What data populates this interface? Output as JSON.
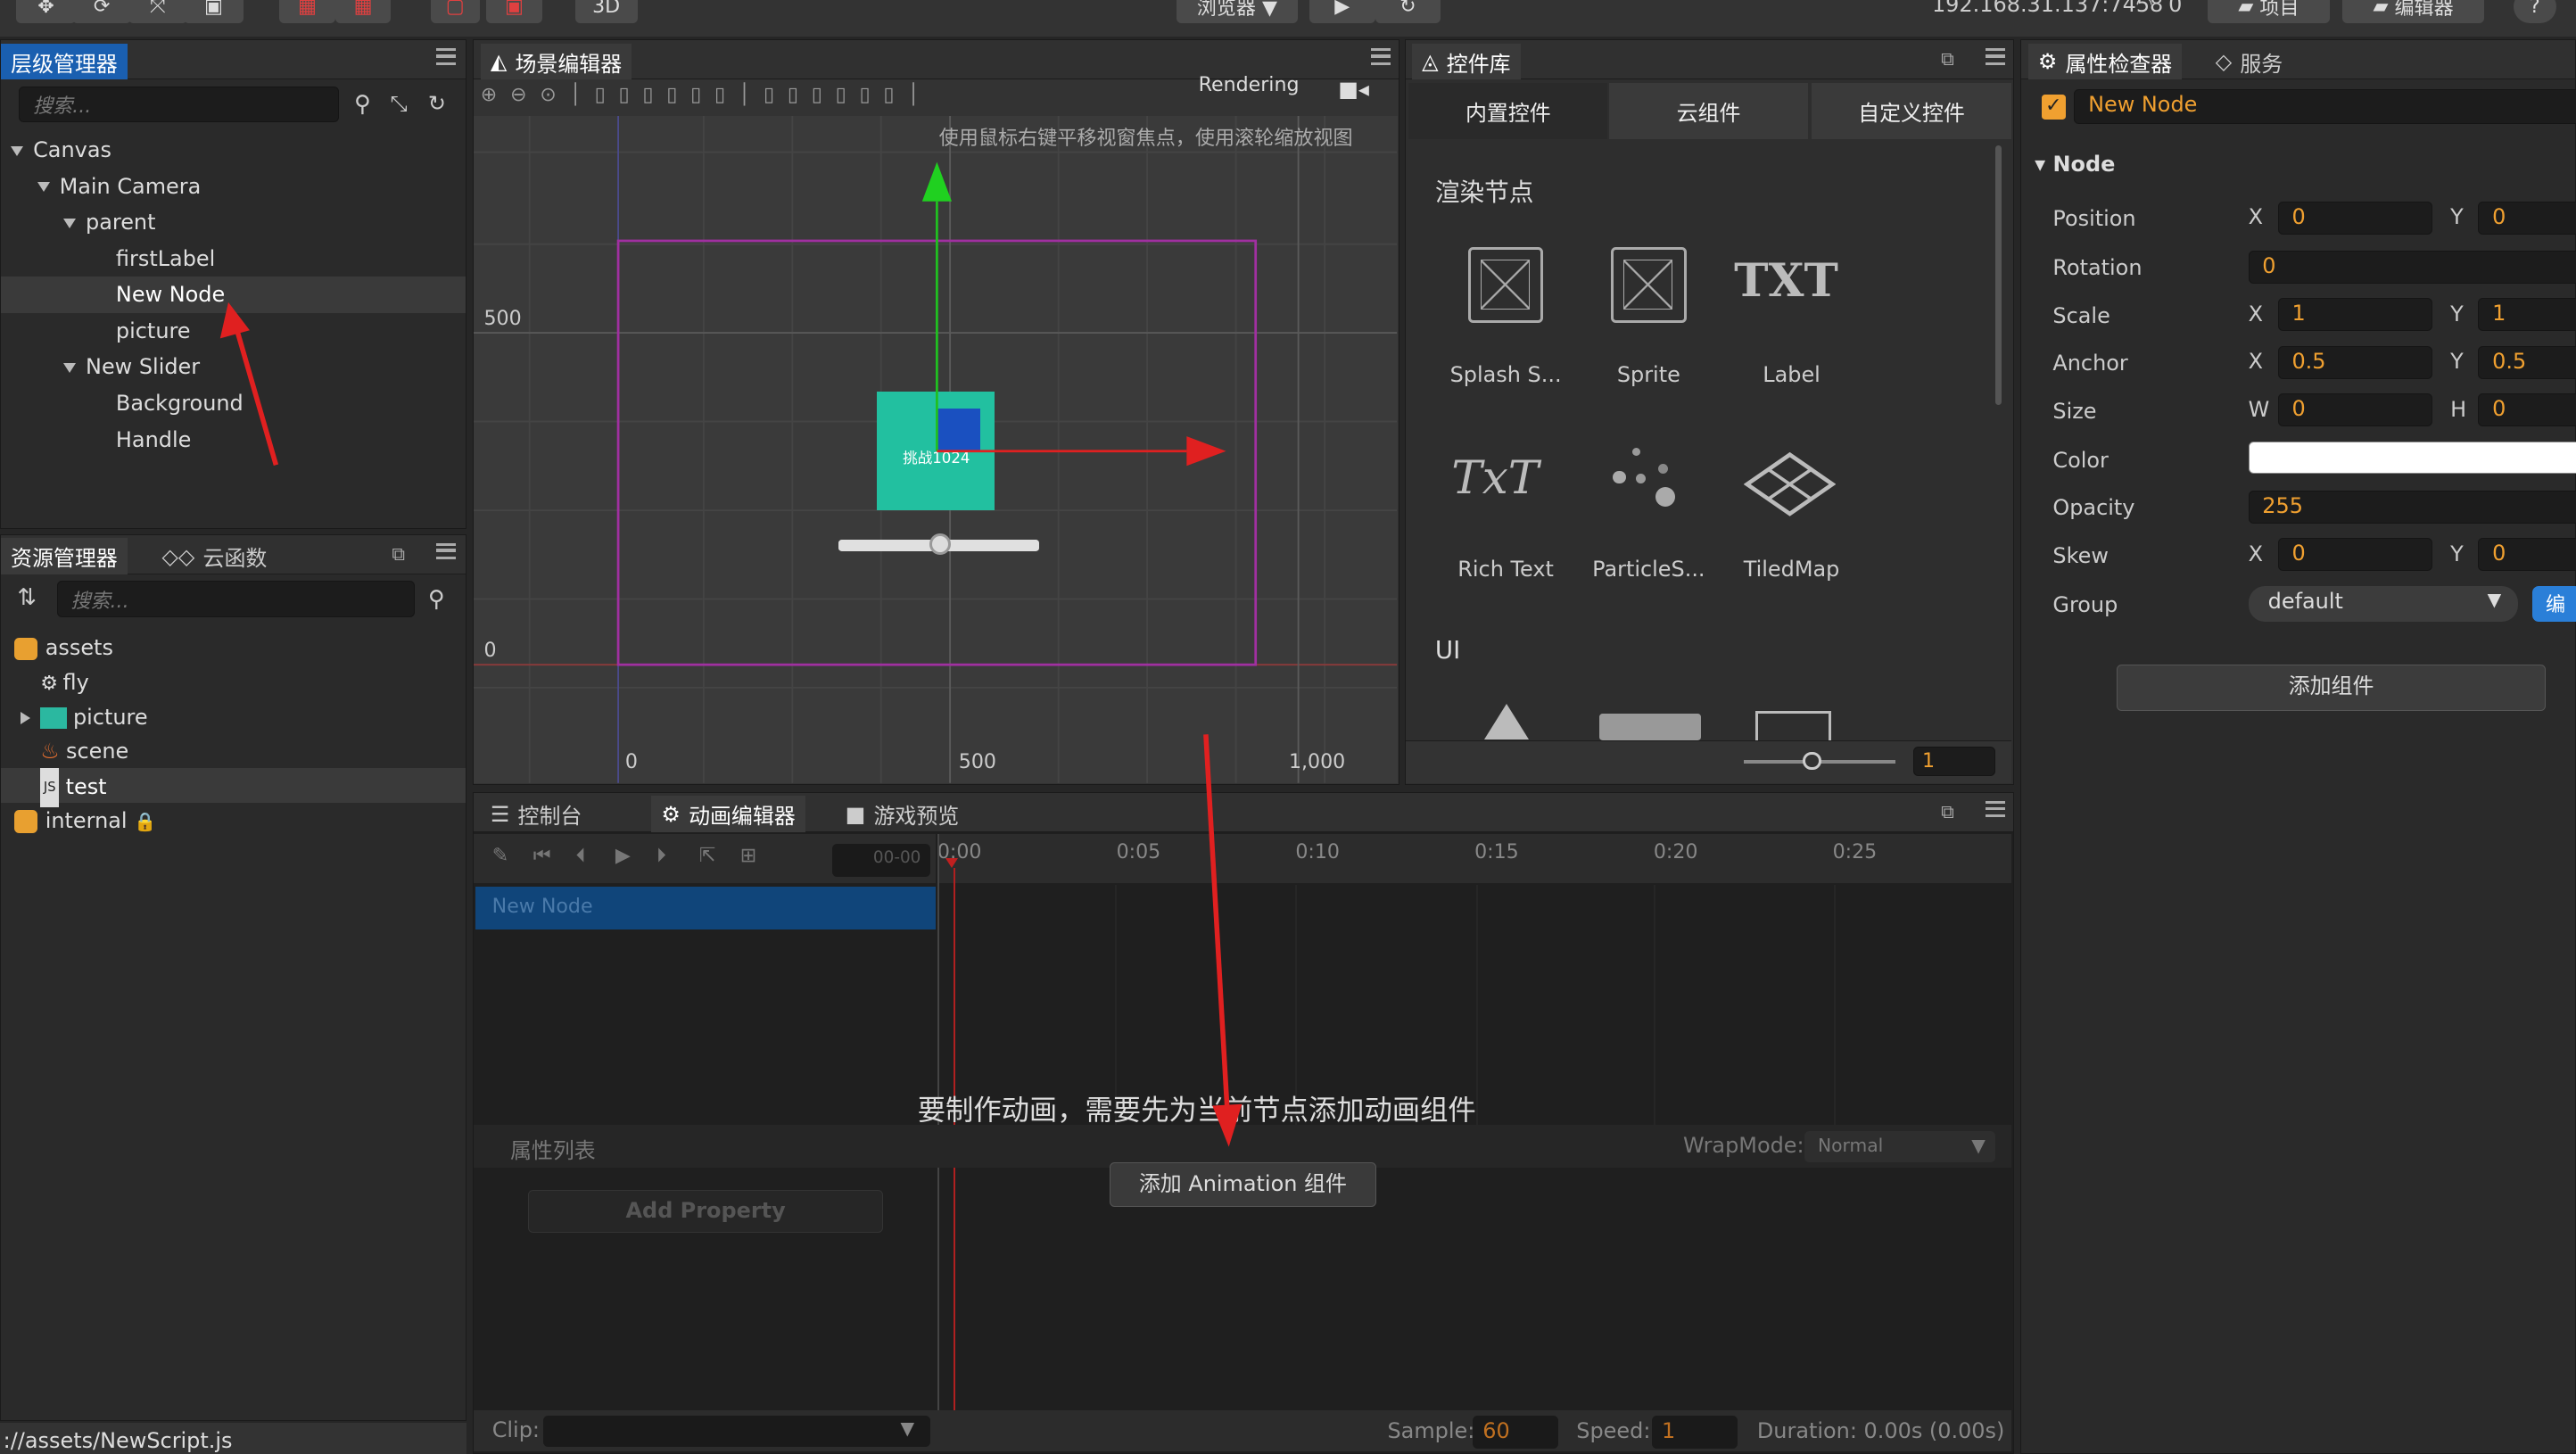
{
  "topbar": {
    "preview_label": "浏览器 ▼",
    "btn_3d": "3D",
    "ip": "192.168.31.137:7458",
    "wifi_count": "0",
    "project_label": "项目",
    "editor_label": "编辑器"
  },
  "hierarchy": {
    "tab": "层级管理器",
    "search_placeholder": "搜索...",
    "items": [
      {
        "label": "Canvas"
      },
      {
        "label": "Main Camera"
      },
      {
        "label": "parent"
      },
      {
        "label": "firstLabel"
      },
      {
        "label": "New Node"
      },
      {
        "label": "picture"
      },
      {
        "label": "New Slider"
      },
      {
        "label": "Background"
      },
      {
        "label": "Handle"
      }
    ]
  },
  "assets": {
    "tab": "资源管理器",
    "tab2": "云函数",
    "search_placeholder": "搜索...",
    "items": [
      {
        "label": "assets"
      },
      {
        "label": "fly"
      },
      {
        "label": "picture"
      },
      {
        "label": "scene"
      },
      {
        "label": "test"
      },
      {
        "label": "internal"
      }
    ],
    "status_path": "://assets/NewScript.js"
  },
  "scene": {
    "tab": "场景编辑器",
    "rendering": "Rendering",
    "hint": "使用鼠标右键平移视窗焦点，使用滚轮缩放视图",
    "y_500": "500",
    "y_0": "0",
    "x_0": "0",
    "x_500": "500",
    "x_1000": "1,000",
    "node_text": "挑战1024"
  },
  "library": {
    "tab": "控件库",
    "subtabs": [
      "内置控件",
      "云组件",
      "自定义控件"
    ],
    "section_render": "渲染节点",
    "section_ui": "UI",
    "items": [
      {
        "label": "Splash S...",
        "icon": "sprite-splash-icon"
      },
      {
        "label": "Sprite",
        "icon": "sprite-icon"
      },
      {
        "label": "Label",
        "icon": "label-txt-icon",
        "glyph": "TXT"
      },
      {
        "label": "Rich Text",
        "icon": "richtext-icon",
        "glyph": "TxT"
      },
      {
        "label": "ParticleS...",
        "icon": "particle-icon"
      },
      {
        "label": "TiledMap",
        "icon": "tiledmap-icon"
      }
    ],
    "zoom_value": "1"
  },
  "inspector": {
    "tab": "属性检查器",
    "tab2": "服务",
    "node_name": "New Node",
    "section": "Node",
    "position": {
      "label": "Position",
      "x": "0",
      "y": "0"
    },
    "rotation": {
      "label": "Rotation",
      "value": "0"
    },
    "scale": {
      "label": "Scale",
      "x": "1",
      "y": "1"
    },
    "anchor": {
      "label": "Anchor",
      "x": "0.5",
      "y": "0.5"
    },
    "size": {
      "label": "Size",
      "w": "0",
      "h": "0"
    },
    "color": {
      "label": "Color",
      "value": "#ffffff"
    },
    "opacity": {
      "label": "Opacity",
      "value": "255"
    },
    "skew": {
      "label": "Skew",
      "x": "0",
      "y": "0"
    },
    "group": {
      "label": "Group",
      "value": "default",
      "edit_btn": "编"
    },
    "x_label": "X",
    "y_label": "Y",
    "w_label": "W",
    "h_label": "H",
    "add_component": "添加组件"
  },
  "bottom": {
    "tabs": [
      "控制台",
      "动画编辑器",
      "游戏预览"
    ],
    "time_field": "00-00",
    "timeline": [
      "0:00",
      "0:05",
      "0:10",
      "0:15",
      "0:20",
      "0:25"
    ],
    "track_node": "New Node",
    "message": "要制作动画，需要先为当前节点添加动画组件",
    "prop_list": "属性列表",
    "wrapmode_label": "WrapMode:",
    "wrapmode_value": "Normal",
    "add_property": "Add Property",
    "add_anim_btn": "添加 Animation 组件",
    "clip_label": "Clip:",
    "sample_label": "Sample:",
    "sample_value": "60",
    "speed_label": "Speed:",
    "speed_value": "1",
    "duration": "Duration: 0.00s (0.00s)"
  },
  "colors": {
    "accent_orange": "#f0a030",
    "selected_blue": "#1a5fb0",
    "annotation_red": "#e02020"
  }
}
